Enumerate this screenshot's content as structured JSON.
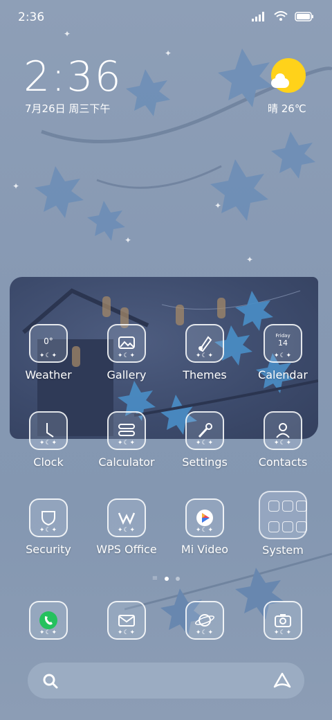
{
  "status_bar": {
    "time": "2:36"
  },
  "clock_widget": {
    "time": "2:36",
    "date": "7月26日 周三下午"
  },
  "weather_widget": {
    "text": "晴 26℃",
    "icon": "sun-cloud-icon"
  },
  "apps": [
    {
      "label": "Weather",
      "icon": "weather-icon",
      "icon_text": "0°"
    },
    {
      "label": "Gallery",
      "icon": "gallery-icon"
    },
    {
      "label": "Themes",
      "icon": "themes-icon"
    },
    {
      "label": "Calendar",
      "icon": "calendar-icon",
      "icon_day": "Friday",
      "icon_date": "14"
    },
    {
      "label": "Clock",
      "icon": "clock-icon"
    },
    {
      "label": "Calculator",
      "icon": "calculator-icon"
    },
    {
      "label": "Settings",
      "icon": "settings-icon"
    },
    {
      "label": "Contacts",
      "icon": "contacts-icon"
    },
    {
      "label": "Security",
      "icon": "security-icon"
    },
    {
      "label": "WPS Office",
      "icon": "wps-office-icon"
    },
    {
      "label": "Mi Video",
      "icon": "mi-video-icon"
    },
    {
      "label": "System",
      "icon": "system-folder-icon"
    }
  ],
  "dock": [
    {
      "name": "phone",
      "icon": "phone-icon"
    },
    {
      "name": "messages",
      "icon": "messages-icon"
    },
    {
      "name": "browser",
      "icon": "browser-planet-icon"
    },
    {
      "name": "camera",
      "icon": "camera-icon"
    }
  ],
  "page_indicator": {
    "pages": 2,
    "current": 1
  },
  "search_bar": {
    "left_icon": "search-icon",
    "right_icon": "assistant-logo-icon"
  },
  "colors": {
    "background": "#8799b3",
    "sun": "#ffd21a",
    "phone_green": "#25c15e"
  }
}
